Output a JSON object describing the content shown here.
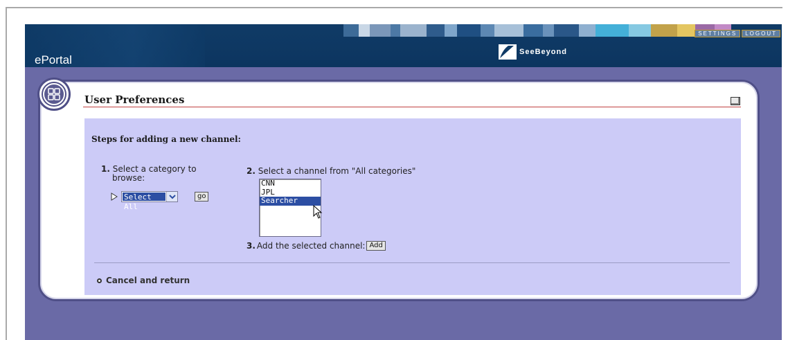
{
  "header": {
    "app_title": "ePortal",
    "brand": "SeeBeyond",
    "settings_label": "SETTINGS",
    "logout_label": "LOGOUT",
    "stripe_colors": [
      "#3d6b98",
      "#c9d7e6",
      "#7b97b9",
      "#4d79a5",
      "#9bb3cd",
      "#2f5c8c",
      "#7fa6cb",
      "#1f4f82",
      "#5d88b3",
      "#a7c0d8",
      "#3a6d9f",
      "#6a92bb",
      "#2a5788",
      "#8fb0d0",
      "#44b0d8",
      "#86c9e2",
      "#c2a24a",
      "#e4c661",
      "#9b6aa5",
      "#c28ac6"
    ]
  },
  "panel": {
    "title": "User Preferences",
    "steps_heading": "Steps for adding a new channel:",
    "step1_num": "1.",
    "step1_line1": "Select a category to",
    "step1_line2": "browse:",
    "category_selected": "Select All",
    "go_label": "go",
    "step2_num": "2.",
    "step2_text": "Select a channel from \"All categories\"",
    "channels": [
      {
        "label": "CNN",
        "selected": false
      },
      {
        "label": "JPL",
        "selected": false
      },
      {
        "label": "Searcher",
        "selected": true
      }
    ],
    "step3_num": "3.",
    "step3_text": "Add the selected channel:",
    "add_label": "Add",
    "cancel_label": "Cancel and return"
  },
  "icons": {
    "round_menu": "grid-menu-icon",
    "minimize": "minimize-icon",
    "arrow": "triangle-right-icon",
    "cursor": "mouse-pointer-icon",
    "brand_mark": "seebeyond-logo-icon"
  },
  "colors": {
    "header_bg": "#103b66",
    "frame_purple": "#6a6aa6",
    "content_lavender": "#cccbf7",
    "selection_blue": "#2c4ea3"
  }
}
